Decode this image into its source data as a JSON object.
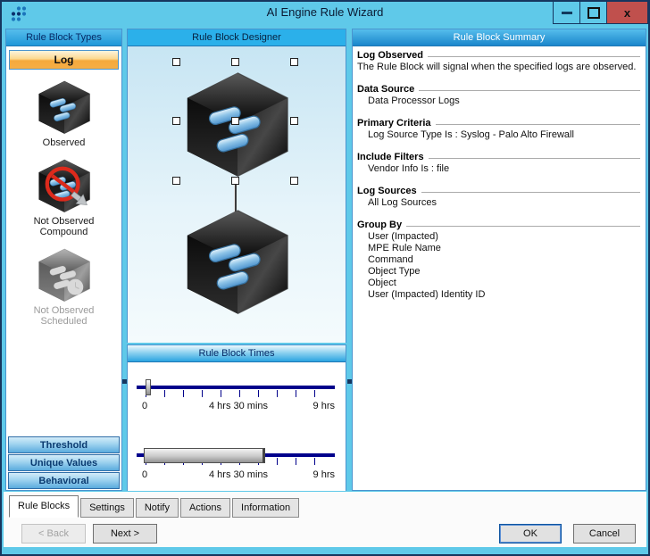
{
  "window": {
    "title": "AI Engine Rule Wizard",
    "minimize_label": "",
    "maximize_label": "",
    "close_label": "x"
  },
  "colors": {
    "titlebar_blue": "#5fc9e9",
    "header_blue": "#2aa3e0",
    "log_button_orange": "#f6a93c",
    "category_button_blue": "#5aabdd",
    "close_button_red": "#c0504d",
    "slider_track_navy": "#00008b",
    "window_border_navy": "#16365f"
  },
  "left_panel": {
    "header": "Rule Block Types",
    "log_button": "Log",
    "types": [
      {
        "label": "Observed",
        "disabled": false
      },
      {
        "label": "Not Observed Compound",
        "disabled": false
      },
      {
        "label": "Not Observed Scheduled",
        "disabled": true
      }
    ],
    "category_buttons": [
      "Threshold",
      "Unique Values",
      "Behavioral"
    ]
  },
  "designer": {
    "header": "Rule Block Designer"
  },
  "times": {
    "header": "Rule Block Times",
    "sliders": [
      {
        "labels": [
          "0",
          "4 hrs 30 mins",
          "9 hrs"
        ]
      },
      {
        "labels": [
          "0",
          "4 hrs 30 mins",
          "9 hrs"
        ]
      }
    ]
  },
  "summary": {
    "header": "Rule Block Summary",
    "sections": [
      {
        "title": "Log Observed",
        "indent": false,
        "lines": [
          "The Rule Block will signal when the specified logs are observed."
        ]
      },
      {
        "title": "Data Source",
        "indent": true,
        "lines": [
          "Data Processor Logs"
        ]
      },
      {
        "title": "Primary Criteria",
        "indent": true,
        "lines": [
          "Log Source Type Is : Syslog - Palo Alto Firewall"
        ]
      },
      {
        "title": "Include Filters",
        "indent": true,
        "lines": [
          "Vendor Info Is : file"
        ]
      },
      {
        "title": "Log Sources",
        "indent": true,
        "lines": [
          "All Log Sources"
        ]
      },
      {
        "title": "Group By",
        "indent": true,
        "lines": [
          "User (Impacted)",
          "MPE Rule Name",
          "Command",
          "Object Type",
          "Object",
          "User (Impacted) Identity ID"
        ]
      }
    ]
  },
  "tabs": [
    {
      "label": "Rule Blocks",
      "active": true
    },
    {
      "label": "Settings",
      "active": false
    },
    {
      "label": "Notify",
      "active": false
    },
    {
      "label": "Actions",
      "active": false
    },
    {
      "label": "Information",
      "active": false
    }
  ],
  "nav": {
    "back": "< Back",
    "next": "Next >",
    "ok": "OK",
    "cancel": "Cancel"
  }
}
